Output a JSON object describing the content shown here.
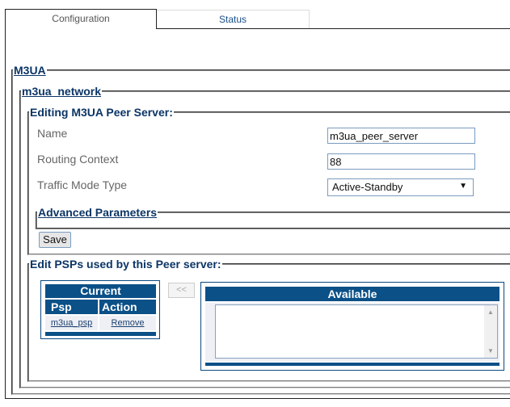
{
  "tabs": [
    {
      "label": "Configuration",
      "active": true
    },
    {
      "label": "Status",
      "active": false
    }
  ],
  "sections": {
    "m3ua": "M3UA",
    "network": "m3ua_network",
    "editing": "Editing M3UA Peer Server:",
    "advanced": "Advanced Parameters",
    "psps": "Edit PSPs used by this Peer server:"
  },
  "form": {
    "name_label": "Name",
    "name_value": "m3ua_peer_server",
    "routing_label": "Routing Context",
    "routing_value": "88",
    "traffic_label": "Traffic Mode Type",
    "traffic_value": "Active-Standby",
    "save_label": "Save"
  },
  "current": {
    "title": "Current",
    "columns": [
      "Psp",
      "Action"
    ],
    "rows": [
      {
        "psp": "m3ua_psp",
        "action": "Remove"
      }
    ]
  },
  "move_button": "<<",
  "available": {
    "title": "Available",
    "items": []
  },
  "colors": {
    "header_blue": "#0b5087",
    "legend_blue": "#0b3566"
  }
}
